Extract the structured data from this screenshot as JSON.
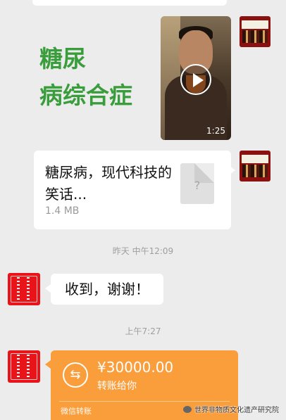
{
  "messages": {
    "green_card": {
      "line1": "糖尿",
      "line2": "病综合症"
    },
    "video": {
      "duration": "1:25"
    },
    "file": {
      "title": "糖尿病，现代科技的笑话...",
      "size": "1.4 MB"
    },
    "timestamp_1": "昨天 中午12:09",
    "reply": "收到，谢谢！",
    "timestamp_2": "上午7:27",
    "transfer": {
      "amount": "¥30000.00",
      "label": "转账给你",
      "footer": "微信转账",
      "icon": "⇆"
    }
  },
  "watermark": "世界非物质文化遗产研究院",
  "colors": {
    "background": "#ececec",
    "transfer": "#fa9d3b",
    "green_text": "#3a9d3c",
    "avatar_red": "#e8141a"
  }
}
